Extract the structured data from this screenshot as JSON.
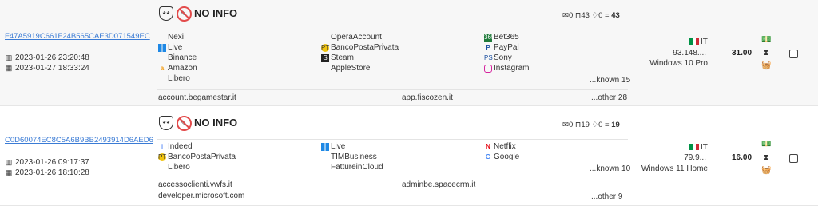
{
  "rows": [
    {
      "hash": "F47A5919C661F24B565CAE3D071549EC",
      "date1": "2023-01-26 23:20:48",
      "date2": "2023-01-27 18:33:24",
      "status": "NO INFO",
      "counts": {
        "mail": "0",
        "bookmarks": "43",
        "gems": "0",
        "total": "43"
      },
      "col1": [
        {
          "label": "Nexi",
          "icon": "none"
        },
        {
          "label": "Live",
          "icon": "windows-icon"
        },
        {
          "label": "Binance",
          "icon": "none"
        },
        {
          "label": "Amazon",
          "icon": "amazon-icon"
        },
        {
          "label": "Libero",
          "icon": "none"
        }
      ],
      "col2": [
        {
          "label": "OperaAccount",
          "icon": "none"
        },
        {
          "label": "BancoPostaPrivata",
          "icon": "bancoposta-icon"
        },
        {
          "label": "Steam",
          "icon": "steam-icon"
        },
        {
          "label": "AppleStore",
          "icon": "apple-icon"
        }
      ],
      "col3": [
        {
          "label": "Bet365",
          "icon": "bet365-icon"
        },
        {
          "label": "PayPal",
          "icon": "paypal-icon"
        },
        {
          "label": "Sony",
          "icon": "sony-icon"
        },
        {
          "label": "Instagram",
          "icon": "instagram-icon"
        }
      ],
      "known": "...known 15",
      "domains_left": [
        "account.begamestar.it"
      ],
      "domains_mid": [
        "app.fiscozen.it"
      ],
      "other": "...other 28",
      "country": "IT",
      "ip": "93.148....",
      "os": "Windows 10 Pro",
      "price": "31.00"
    },
    {
      "hash": "C0D60074EC8C5A6B9BB2493914D6AED6",
      "date1": "2023-01-26 09:17:37",
      "date2": "2023-01-26 18:10:28",
      "status": "NO INFO",
      "counts": {
        "mail": "0",
        "bookmarks": "19",
        "gems": "0",
        "total": "19"
      },
      "col1": [
        {
          "label": "Indeed",
          "icon": "indeed-icon"
        },
        {
          "label": "BancoPostaPrivata",
          "icon": "bancoposta-icon"
        },
        {
          "label": "Libero",
          "icon": "none"
        }
      ],
      "col2": [
        {
          "label": "Live",
          "icon": "windows-icon"
        },
        {
          "label": "TIMBusiness",
          "icon": "none"
        },
        {
          "label": "FattureinCloud",
          "icon": "none"
        }
      ],
      "col3": [
        {
          "label": "Netflix",
          "icon": "netflix-icon"
        },
        {
          "label": "Google",
          "icon": "google-icon"
        }
      ],
      "known": "...known 10",
      "domains_left": [
        "accessoclienti.vwfs.it",
        "developer.microsoft.com"
      ],
      "domains_mid": [
        "adminbe.spacecrm.it"
      ],
      "other": "...other 9",
      "country": "IT",
      "ip": "79.9...",
      "os": "Windows 11 Home",
      "price": "16.00"
    }
  ],
  "icons": {
    "mask": "anonymous-mask-icon",
    "noinfo": "no-info-icon",
    "mail": "mail-icon",
    "bookmark": "bookmark-icon",
    "gem": "gem-icon",
    "calendar1": "calendar-icon",
    "calendar2": "calendar-check-icon",
    "money": "money-icon",
    "hourglass": "hourglass-icon",
    "basket": "basket-icon"
  },
  "colors": {
    "link": "#3a7bd5",
    "noinfo_red": "#e34b4b",
    "row_alt": "#f7f7f7"
  }
}
